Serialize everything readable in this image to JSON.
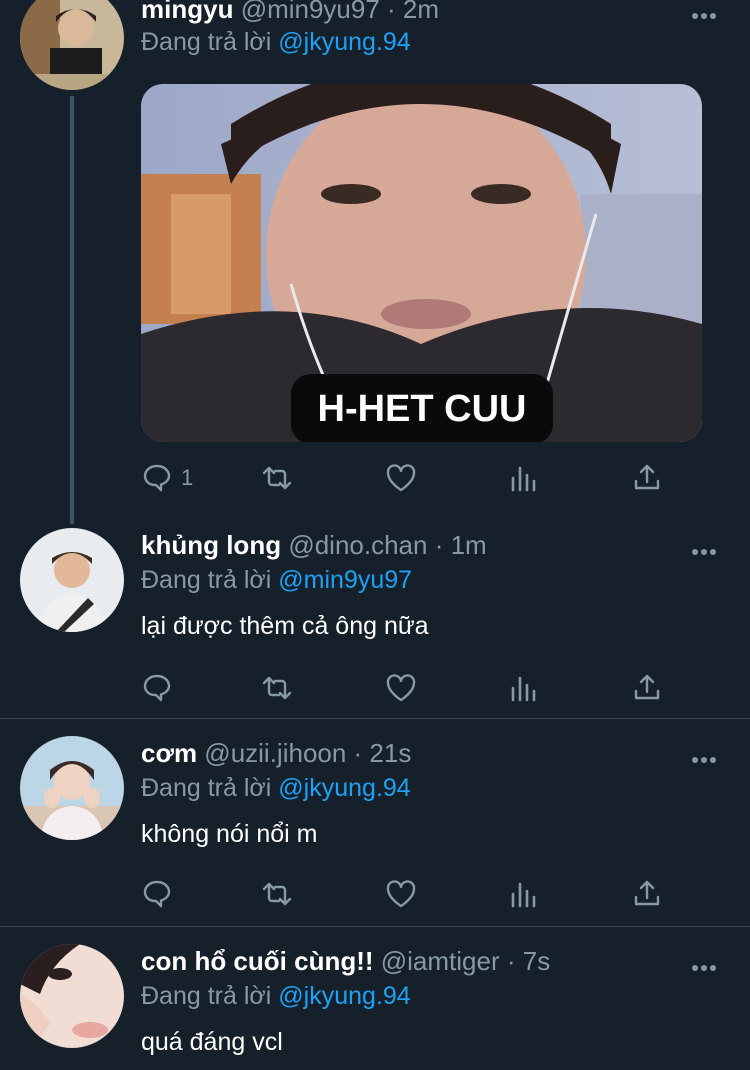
{
  "tweets": [
    {
      "name": "mingyu",
      "handle": "@min9yu97 · 2m",
      "reply_prefix": "Đang trả lời",
      "reply_to": "@jkyung.94",
      "media_caption": "H-HET CUU",
      "reply_count": "1"
    },
    {
      "name": "khủng long",
      "handle": "@dino.chan · 1m",
      "reply_prefix": "Đang trả lời",
      "reply_to": "@min9yu97",
      "text": "lại được thêm cả ông nữa"
    },
    {
      "name": "cơm",
      "handle": "@uzii.jihoon · 21s",
      "reply_prefix": "Đang trả lời",
      "reply_to": "@jkyung.94",
      "text": "không nói nổi m"
    },
    {
      "name": "con hổ cuối cùng!!",
      "handle": "@iamtiger · 7s",
      "reply_prefix": "Đang trả lời",
      "reply_to": "@jkyung.94",
      "text": "quá đáng vcl"
    }
  ],
  "icons": {
    "reply": "reply-icon",
    "retweet": "retweet-icon",
    "like": "heart-icon",
    "analytics": "analytics-icon",
    "share": "share-icon",
    "more": "more-icon"
  },
  "colors": {
    "background": "#15202b",
    "accent": "#1da1f2",
    "secondary_text": "#8899a6",
    "divider": "#38444d"
  }
}
